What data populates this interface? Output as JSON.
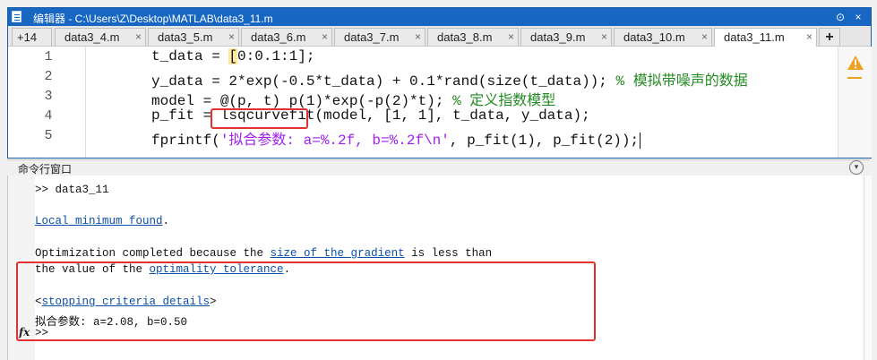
{
  "window": {
    "title": "编辑器 - C:\\Users\\Z\\Desktop\\MATLAB\\data3_11.m",
    "menu_glyph": "⊙",
    "close_glyph": "×"
  },
  "tabs": {
    "more_label": "+14",
    "items": [
      {
        "label": "data3_4.m"
      },
      {
        "label": "data3_5.m"
      },
      {
        "label": "data3_6.m"
      },
      {
        "label": "data3_7.m"
      },
      {
        "label": "data3_8.m"
      },
      {
        "label": "data3_9.m"
      },
      {
        "label": "data3_10.m"
      },
      {
        "label": "data3_11.m",
        "active": true
      }
    ],
    "close_glyph": "×",
    "add_glyph": "+"
  },
  "editor": {
    "line_numbers": [
      "1",
      "2",
      "3",
      "4",
      "5"
    ],
    "lines": [
      {
        "pre": "t_data = ",
        "bracket": "[",
        "code": "0:0.1:1];"
      },
      {
        "code": "y_data = 2*exp(-0.5*t_data) + 0.1*rand(size(t_data)); ",
        "comment": "% 模拟带噪声的数据"
      },
      {
        "code": "model = @(p, t) p(1)*exp(-p(2)*t); ",
        "comment": "% 定义指数模型"
      },
      {
        "pre": "p_fit = ",
        "highlight": "lsqcurvefit",
        "code": "(model, [1, 1], t_data, y_data);"
      },
      {
        "pre": "fprintf(",
        "string": "'拟合参数: a=%.2f, b=%.2f\\n'",
        "code": ", p_fit(1), p_fit(2));"
      }
    ],
    "warning_icon": "warning-triangle-icon",
    "warning_color": "#f0a020"
  },
  "command_window": {
    "header": "命令行窗口",
    "prompt_line": ">> data3_11",
    "local_min_link": "Local minimum found",
    "local_min_suffix": ".",
    "opt_line1_pre": "Optimization completed because the ",
    "opt_line1_link": "size of the gradient",
    "opt_line1_post": " is less than",
    "opt_line2_pre": "the value of the ",
    "opt_line2_link": "optimality tolerance",
    "opt_line2_post": ".",
    "criteria_pre": "<",
    "criteria_link": "stopping criteria details",
    "criteria_post": ">",
    "result_line": "拟合参数: a=2.08, b=0.50",
    "fx_label": "fx",
    "empty_prompt": ">>"
  },
  "colors": {
    "title_bar": "#1766c2",
    "link": "#0b4fa8",
    "comment": "#228b22",
    "string": "#a020f0",
    "annotation_box": "#e53030"
  }
}
